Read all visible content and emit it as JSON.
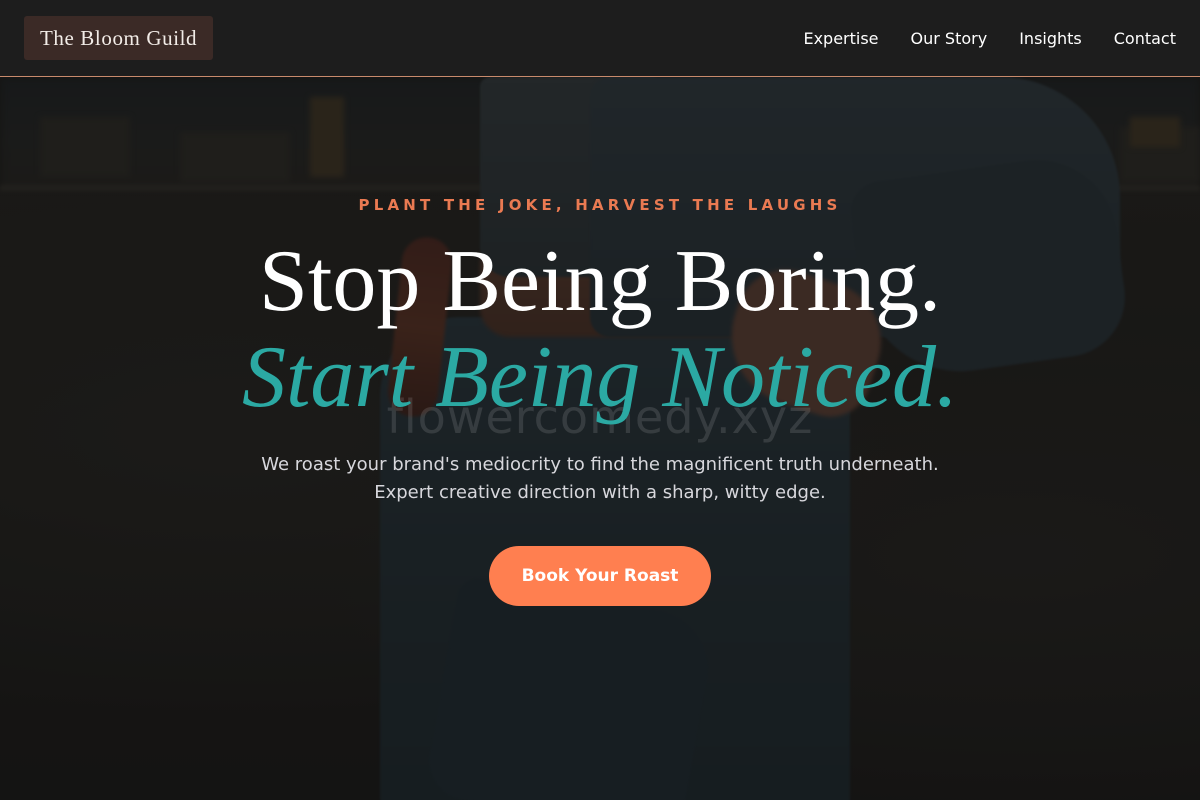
{
  "header": {
    "logo": "The Bloom Guild",
    "nav": [
      "Expertise",
      "Our Story",
      "Insights",
      "Contact"
    ]
  },
  "hero": {
    "eyebrow": "PLANT THE JOKE, HARVEST THE LAUGHS",
    "headline_line1": "Stop Being Boring.",
    "headline_line2": "Start Being Noticed.",
    "subtext": "We roast your brand's mediocrity to find the magnificent truth underneath. Expert creative direction with a sharp, witty edge.",
    "cta_label": "Book Your Roast",
    "watermark": "flowercomedy.xyz"
  },
  "colors": {
    "accent": "#ff7f50",
    "eyebrow": "#ea7a52",
    "headline_accent": "#2ba9a3",
    "header_bg": "#1d1d1d",
    "logo_bg": "#3b2a26",
    "header_border": "#c88a6c"
  }
}
